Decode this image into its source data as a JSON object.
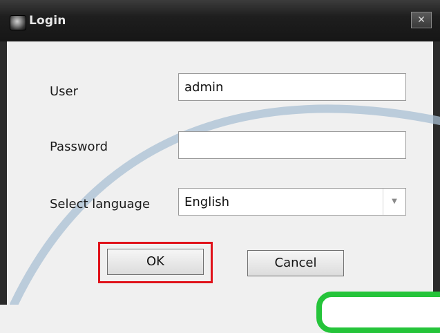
{
  "window": {
    "title": "Login",
    "close_label": "✕"
  },
  "form": {
    "user_label": "User",
    "user_value": "admin",
    "password_label": "Password",
    "password_value": "",
    "language_label": "Select language",
    "language_value": "English"
  },
  "buttons": {
    "ok_label": "OK",
    "cancel_label": "Cancel"
  },
  "icons": {
    "app": "app-logo-icon",
    "close": "close-icon",
    "dropdown": "chevron-down-icon"
  },
  "colors": {
    "highlight": "#e0121a",
    "callout": "#25c43a",
    "arc": "#a9c0d4"
  }
}
